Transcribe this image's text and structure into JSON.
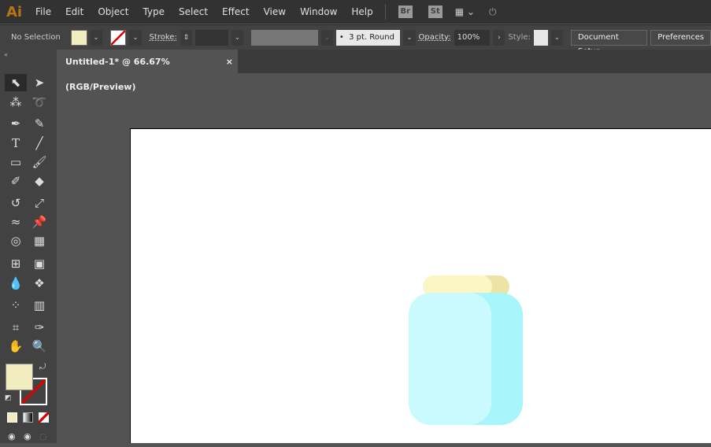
{
  "app": {
    "logo": "Ai"
  },
  "menu": [
    "File",
    "Edit",
    "Object",
    "Type",
    "Select",
    "Effect",
    "View",
    "Window",
    "Help"
  ],
  "menu_icons": {
    "bridge": "Br",
    "stock": "St",
    "workspace": "layout-icon",
    "sync": "gpu-power-icon"
  },
  "control": {
    "selection": "No Selection",
    "fill_color": "#f2edbf",
    "stroke_label": "Stroke:",
    "brush": "3 pt. Round",
    "opacity_label": "Opacity:",
    "opacity": "100%",
    "style_label": "Style:",
    "document_setup": "Document Setup",
    "preferences": "Preferences"
  },
  "tab": {
    "title": "Untitled-1* @ 66.67% (RGB/Preview)",
    "close": "×"
  },
  "tools": [
    "selection",
    "direct-selection",
    "magic-wand",
    "lasso",
    "pen",
    "curvature",
    "type",
    "line",
    "rectangle",
    "paintbrush",
    "shaper",
    "eraser",
    "rotate",
    "scale",
    "width",
    "puppet-warp",
    "shape-builder",
    "perspective-grid",
    "mesh",
    "gradient",
    "eyedropper",
    "blend",
    "symbol-sprayer",
    "column-graph",
    "artboard",
    "slice",
    "hand",
    "zoom"
  ],
  "colors": {
    "fill": "#f2edbf",
    "lid_light": "#fbf6c4",
    "lid_dark": "#ece3a6",
    "body_light": "#c9fbfe",
    "body_dark": "#a8f5fc"
  }
}
